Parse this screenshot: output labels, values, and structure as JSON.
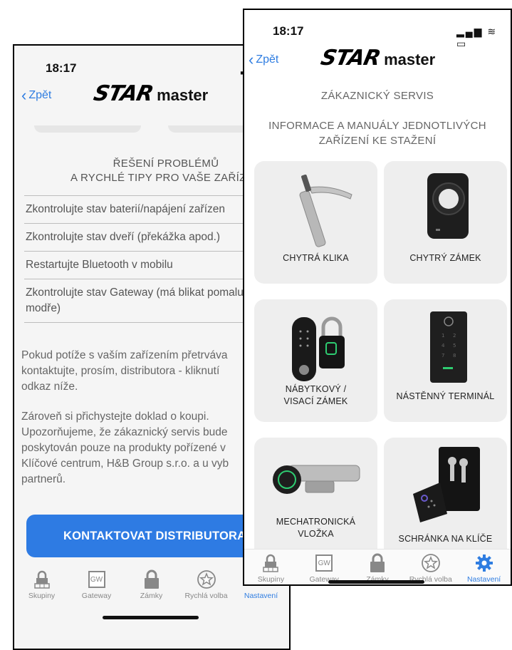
{
  "back_screen": {
    "time": "18:17",
    "back_label": "Zpět",
    "logo": {
      "star": "STAR",
      "master": "master"
    },
    "section_title_line1": "ŘEŠENÍ PROBLÉMŮ",
    "section_title_line2": "A RYCHLÉ TIPY PRO VAŠE ZAŘÍZEN",
    "tips": [
      "Zkontrolujte stav baterií/napájení zařízen",
      "Zkontrolujte stav dveří (překážka apod.)",
      "Restartujte Bluetooth v mobilu",
      "Zkontrolujte stav Gateway (má blikat pomalu modře)"
    ],
    "paragraph1": "Pokud potíže s vaším zařízením přetrváva\nkontaktujte, prosím, distributora - kliknutí\nodkaz níže.",
    "paragraph2": "Zároveň si přichystejte doklad o koupi.\nUpozorňujeme, že zákaznický servis bude\nposkytován pouze na produkty pořízené v\nKlíčové centrum, H&B Group s.r.o. a u vyb\npartnerů.",
    "contact_button": "KONTAKTOVAT DISTRIBUTORA"
  },
  "front_screen": {
    "time": "18:17",
    "back_label": "Zpět",
    "logo": {
      "star": "STAR",
      "master": "master"
    },
    "title": "ZÁKAZNICKÝ SERVIS",
    "subtitle_line1": "INFORMACE A MANUÁLY JEDNOTLIVÝCH",
    "subtitle_line2": "ZAŘÍZENÍ KE STAŽENÍ",
    "cards": [
      {
        "label_line1": "CHYTRÁ KLIKA",
        "label_line2": ""
      },
      {
        "label_line1": "CHYTRÝ ZÁMEK",
        "label_line2": ""
      },
      {
        "label_line1": "NÁBYTKOVÝ /",
        "label_line2": "VISACÍ ZÁMEK"
      },
      {
        "label_line1": "NÁSTĚNNÝ TERMINÁL",
        "label_line2": ""
      },
      {
        "label_line1": "MECHATRONICKÁ",
        "label_line2": "VLOŽKA"
      },
      {
        "label_line1": "SCHRÁNKA NA KLÍČE",
        "label_line2": ""
      }
    ]
  },
  "tabs": [
    {
      "label": "Skupiny",
      "icon": "lock-group-icon"
    },
    {
      "label": "Gateway",
      "icon": "gateway-icon",
      "badge": "GW"
    },
    {
      "label": "Zámky",
      "icon": "padlock-icon"
    },
    {
      "label": "Rychlá volba",
      "icon": "star-circle-icon"
    },
    {
      "label": "Nastavení",
      "icon": "gear-icon",
      "active": true
    }
  ],
  "colors": {
    "accent": "#2f7de1",
    "button": "#2e7be3",
    "card_bg": "#eeeeee"
  }
}
